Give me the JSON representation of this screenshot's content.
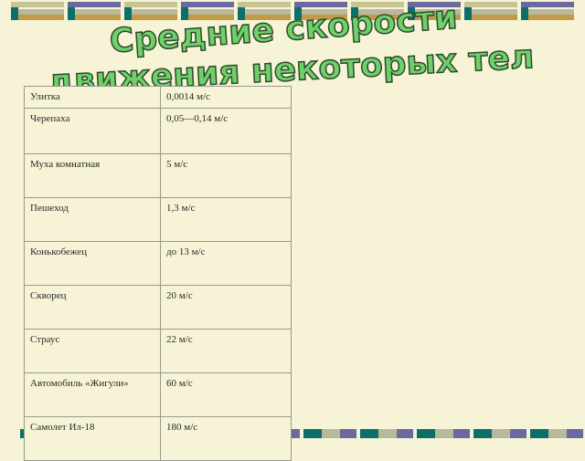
{
  "title": {
    "line1": "Средние скорости",
    "line2": "движения некоторых тел",
    "fill_color": "#6fd06a",
    "outline_color": "#2b4a2b"
  },
  "table": {
    "rows": [
      {
        "name": "Улитка",
        "value": "0,0014 м/с"
      },
      {
        "name": "Черепаха",
        "value": "0,05—0,14 м/с"
      },
      {
        "name": "Муха комнатная",
        "value": "5 м/с"
      },
      {
        "name": "Пешеход",
        "value": "1,3 м/с"
      },
      {
        "name": "Конькобежец",
        "value": "до 13 м/с"
      },
      {
        "name": "Скворец",
        "value": "20 м/с"
      },
      {
        "name": "Страус",
        "value": "22 м/с"
      },
      {
        "name": "Автомобиль «Жигули»",
        "value": "60 м/с"
      },
      {
        "name": "Самолет Ил-18",
        "value": "180 м/с"
      }
    ]
  }
}
